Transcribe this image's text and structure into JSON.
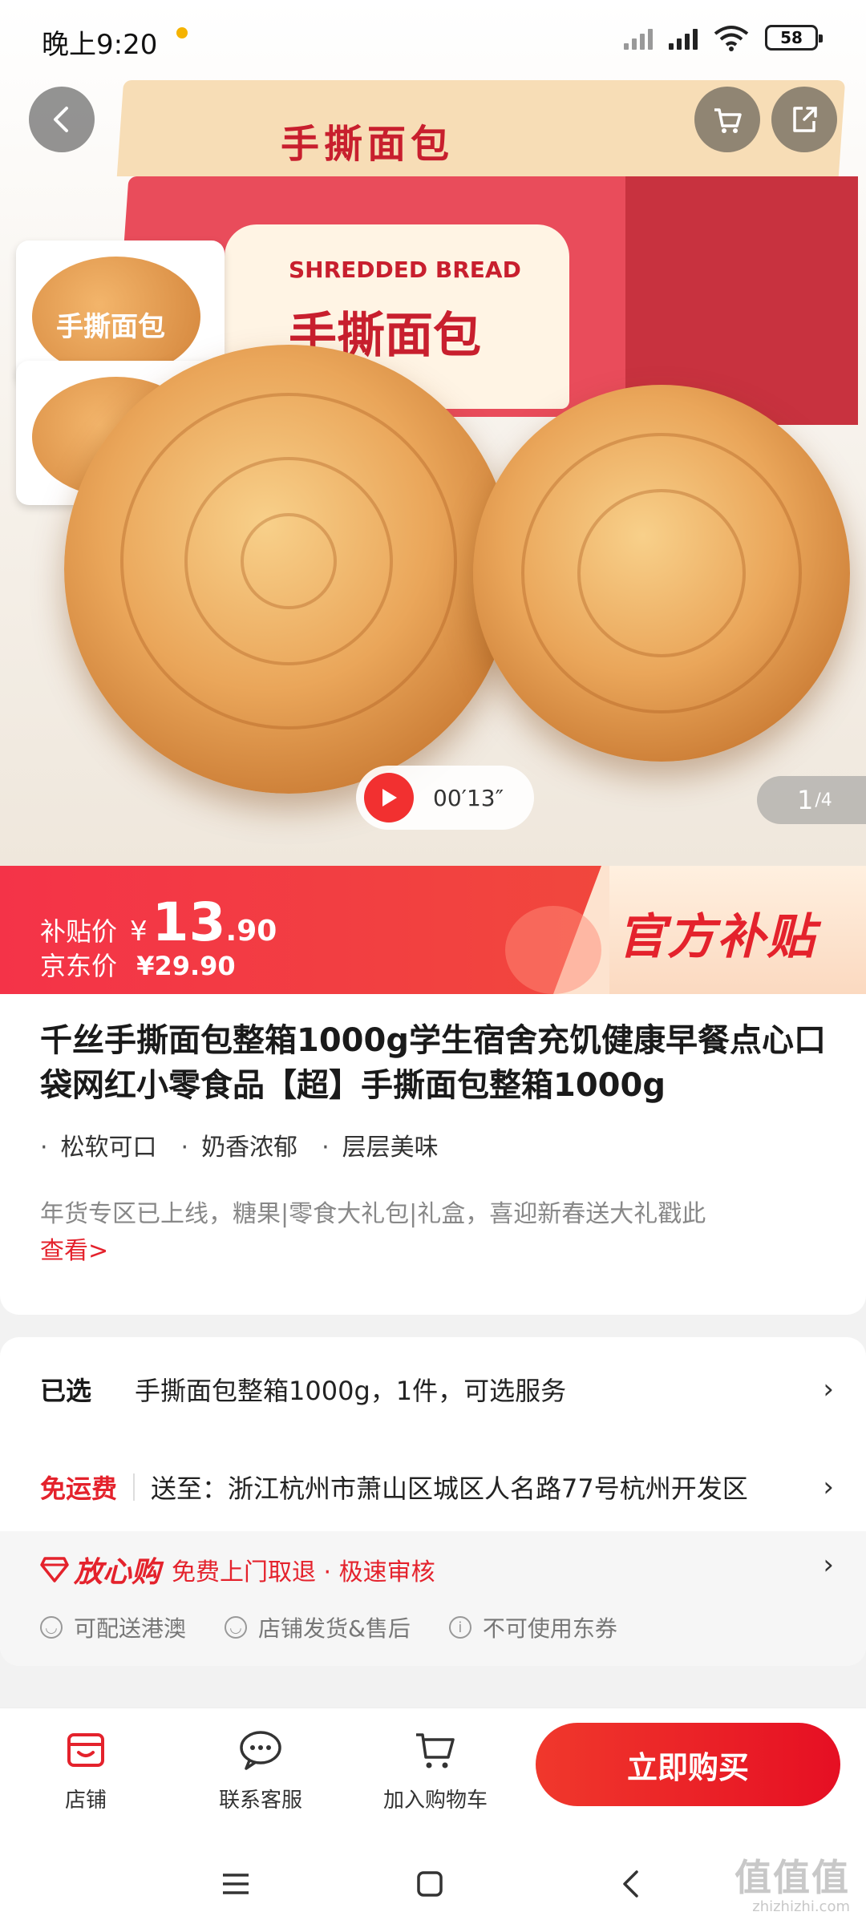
{
  "status_bar": {
    "time": "晚上9:20",
    "battery": "58"
  },
  "hero": {
    "video_duration": "00′13″",
    "pager_current": "1",
    "pager_total": "/4",
    "box_top_text": "手撕面包",
    "box_brand_text": "SHREDDED BREAD",
    "box_title_text": "手撕面包",
    "pack_text": "手撕面包"
  },
  "price": {
    "subsidy_label": "补贴价",
    "currency": "¥",
    "subsidy_int": "13",
    "subsidy_dec": ".90",
    "jd_label": "京东价",
    "jd_value": "¥29.90",
    "badge": "官方补贴"
  },
  "product": {
    "title": "千丝手撕面包整箱1000g学生宿舍充饥健康早餐点心口袋网红小零食品【超】手撕面包整箱1000g",
    "tags": [
      "松软可口",
      "奶香浓郁",
      "层层美味"
    ],
    "promo_text": "年货专区已上线，糖果|零食大礼包|礼盒，喜迎新春送大礼戳此",
    "promo_link": "查看>"
  },
  "options": {
    "selected_label": "已选",
    "selected_value": "手撕面包整箱1000g，1件，可选服务",
    "ship_label": "免运费",
    "ship_value": "送至：浙江杭州市萧山区城区人名路77号杭州开发区",
    "assure_brand": "放心购",
    "assure_desc": "免费上门取退 · 极速审核",
    "features": [
      "可配送港澳",
      "店铺发货&售后",
      "不可使用东券"
    ]
  },
  "bottom_bar": {
    "store": "店铺",
    "service": "联系客服",
    "cart": "加入购物车",
    "buy": "立即购买"
  },
  "watermark": {
    "big": "值值值",
    "small": "zhizhizhi.com"
  },
  "colors": {
    "accent_red": "#e4222c",
    "price_red": "#f43348",
    "buy_button": "#e60f23"
  }
}
